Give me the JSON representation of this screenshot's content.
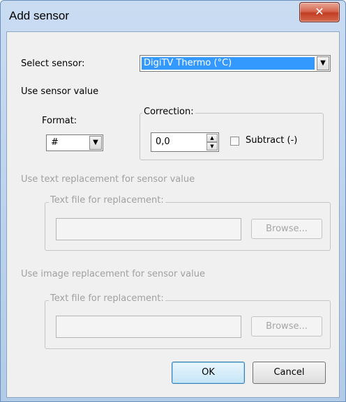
{
  "window": {
    "title": "Add sensor",
    "close_glyph": "✕"
  },
  "select_sensor": {
    "label": "Select sensor:",
    "value": "DigiTV Thermo (°C)"
  },
  "sensor_value": {
    "section_label": "Use sensor value",
    "format_label": "Format:",
    "format_value": "#",
    "correction_label": "Correction:",
    "correction_value": "0,0",
    "subtract_label": "Subtract (-)"
  },
  "text_replacement": {
    "section_label": "Use text replacement for sensor value",
    "group_label": "Text file for replacement:",
    "file_value": "",
    "browse_label": "Browse..."
  },
  "image_replacement": {
    "section_label": "Use image replacement for sensor value",
    "group_label": "Text file for replacement:",
    "file_value": "",
    "browse_label": "Browse..."
  },
  "buttons": {
    "ok_label": "OK",
    "cancel_label": "Cancel"
  }
}
